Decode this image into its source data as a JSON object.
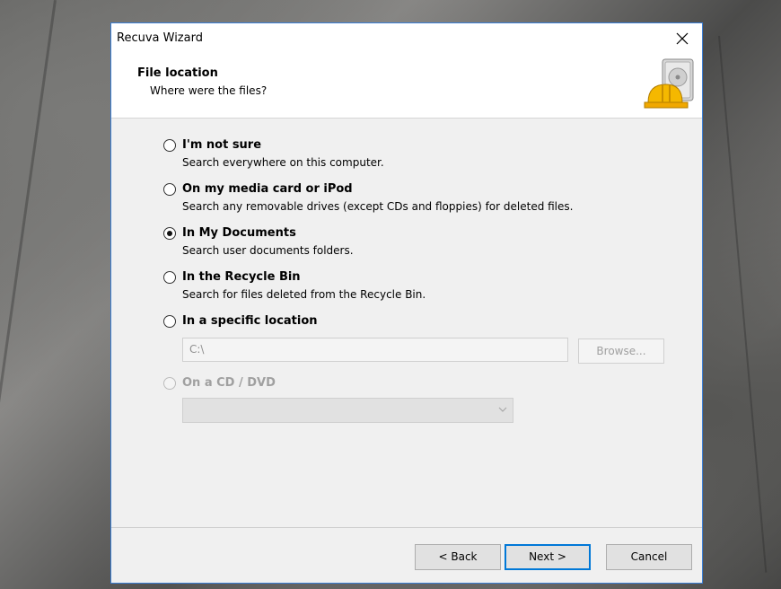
{
  "window": {
    "title": "Recuva Wizard"
  },
  "header": {
    "title": "File location",
    "subtitle": "Where were the files?",
    "icon": "hard-drive-with-helmet-icon"
  },
  "options": [
    {
      "label": "I'm not sure",
      "description": "Search everywhere on this computer.",
      "selected": false,
      "enabled": true
    },
    {
      "label": "On my media card or iPod",
      "description": "Search any removable drives (except CDs and floppies) for deleted files.",
      "selected": false,
      "enabled": true
    },
    {
      "label": "In My Documents",
      "description": "Search user documents folders.",
      "selected": true,
      "enabled": true
    },
    {
      "label": "In the Recycle Bin",
      "description": "Search for files deleted from the Recycle Bin.",
      "selected": false,
      "enabled": true
    },
    {
      "label": "In a specific location",
      "description": "",
      "selected": false,
      "enabled": true
    },
    {
      "label": "On a CD / DVD",
      "description": "",
      "selected": false,
      "enabled": false
    }
  ],
  "specific_location": {
    "path_value": "C:\\",
    "browse_label": "Browse..."
  },
  "cd_dvd": {
    "selected_value": ""
  },
  "footer": {
    "back_label": "< Back",
    "next_label": "Next >",
    "cancel_label": "Cancel"
  },
  "colors": {
    "accent": "#0078d7",
    "window_border": "#3b7fd6"
  }
}
